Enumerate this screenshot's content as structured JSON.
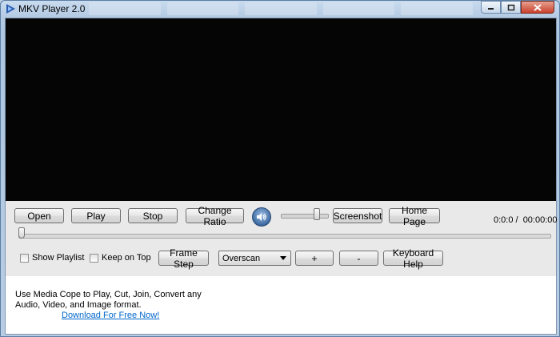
{
  "window": {
    "title": "MKV Player 2.0",
    "minimize_icon": "minimize-icon",
    "maximize_icon": "maximize-icon",
    "close_icon": "close-icon"
  },
  "controls": {
    "open_label": "Open",
    "play_label": "Play",
    "stop_label": "Stop",
    "change_ratio_label": "Change Ratio",
    "screenshot_label": "Screenshot",
    "home_page_label": "Home Page",
    "volume_icon": "speaker-icon",
    "volume_level": 0.82,
    "time_readout": "0:0:0 /  00:00:00",
    "seek_position": 0.0
  },
  "options": {
    "show_playlist_label": "Show Playlist",
    "show_playlist_checked": false,
    "keep_on_top_label": "Keep on Top",
    "keep_on_top_checked": false,
    "frame_step_label": "Frame Step",
    "scan_mode_selected": "Overscan",
    "plus_label": "+",
    "minus_label": "-",
    "keyboard_help_label": "Keyboard Help"
  },
  "promo": {
    "line1": "Use Media Cope to Play, Cut, Join, Convert any",
    "line2": "Audio, Video, and Image format.",
    "link_text": "Download For Free Now!"
  },
  "colors": {
    "video_background": "#050505",
    "link": "#0066cc",
    "close_button": "#c8412b"
  }
}
